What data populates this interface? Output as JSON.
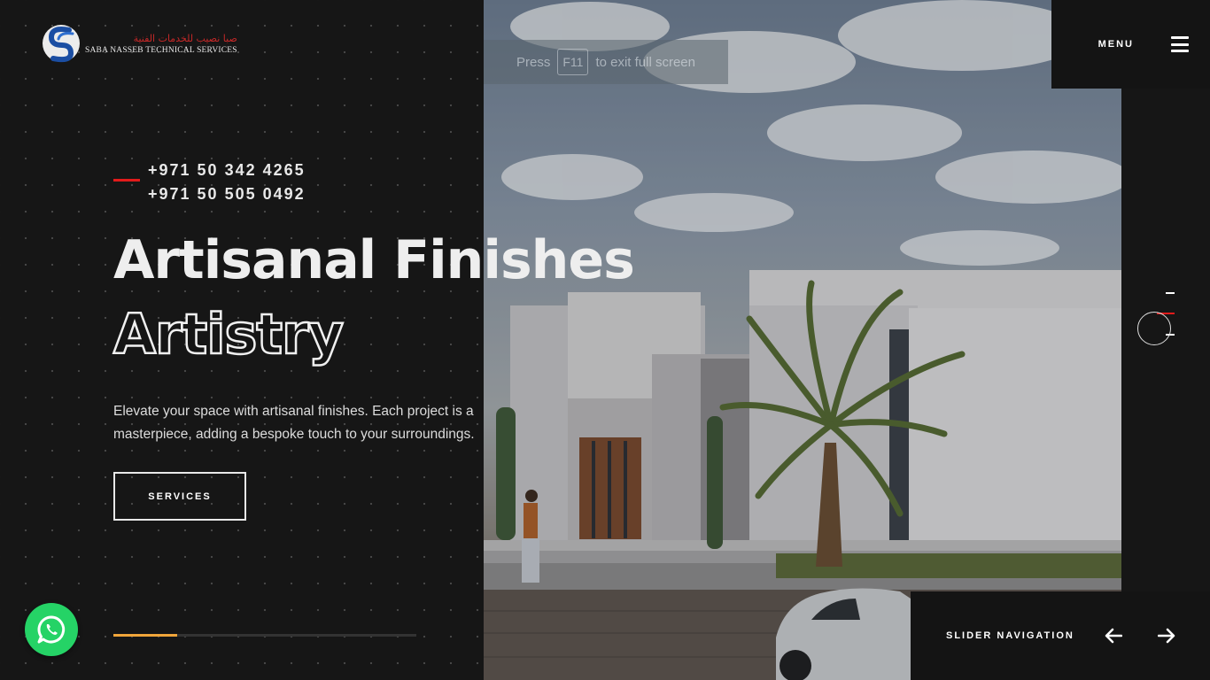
{
  "brand": {
    "name_ar": "صبا نصيب للخدمات الفنية",
    "name_en": "SABA NASSEB TECHNICAL SERVICES"
  },
  "fullscreen_notice": {
    "prefix": "Press",
    "key": "F11",
    "suffix": "to exit full screen"
  },
  "header": {
    "menu_label": "MENU"
  },
  "contact": {
    "phones": [
      "+971 50 342 4265",
      "+971 50 505 0492"
    ]
  },
  "hero": {
    "title": "Artisanal Finishes",
    "title_outline": "Artistry",
    "description": "Elevate your space with artisanal finishes. Each project is a masterpiece, adding a bespoke touch to your surroundings.",
    "cta_label": "SERVICES"
  },
  "slider": {
    "nav_label": "SLIDER NAVIGATION",
    "progress": 0.21
  },
  "colors": {
    "accent_red": "#e21b1b",
    "progress_orange": "#f0a53a",
    "whatsapp_green": "#25d366",
    "background": "#141414"
  },
  "icons": {
    "menu": "hamburger-icon",
    "prev": "arrow-left-icon",
    "next": "arrow-right-icon",
    "chat": "whatsapp-icon"
  }
}
